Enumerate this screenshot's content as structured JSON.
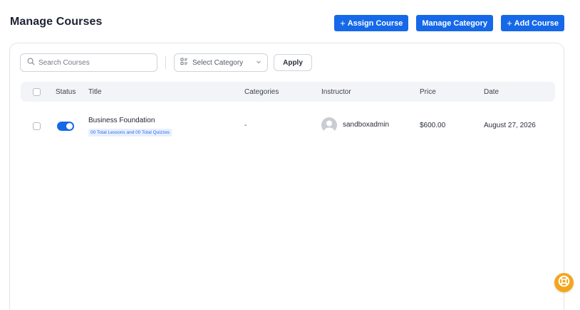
{
  "page": {
    "title": "Manage Courses"
  },
  "header_actions": {
    "assign_course": "Assign Course",
    "manage_category": "Manage Category",
    "add_course": "Add Course"
  },
  "filters": {
    "search_placeholder": "Search Courses",
    "category_select": "Select Category",
    "apply": "Apply"
  },
  "table": {
    "columns": {
      "status": "Status",
      "title": "Title",
      "categories": "Categories",
      "instructor": "Instructor",
      "price": "Price",
      "date": "Date"
    },
    "rows": [
      {
        "status": "enabled",
        "title": "Business Foundation",
        "summary": "00 Total Lessons and 00 Total Quizzes",
        "categories": "-",
        "instructor": "sandboxadmin",
        "price": "$600.00",
        "date": "August 27, 2026"
      }
    ]
  },
  "colors": {
    "primary": "#1569e8",
    "help_button": "#f5a51c",
    "badge_bg": "#e8f0ff"
  },
  "icons": {
    "search": "search-icon",
    "category": "category-list-icon",
    "dropdown": "chevron-down-icon",
    "plus": "plus-icon",
    "help": "lifebuoy-icon",
    "avatar": "user-avatar-icon"
  }
}
